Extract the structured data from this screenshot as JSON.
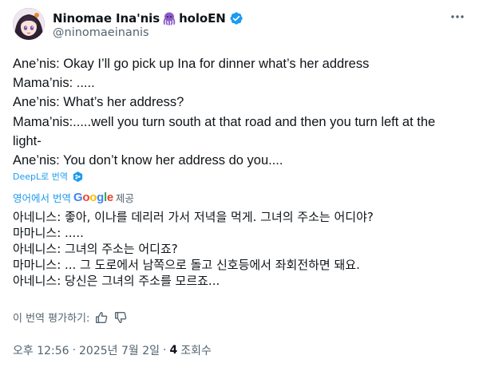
{
  "author": {
    "display_name": "Ninomae Ina'nis",
    "emoji_icon": "octopus-icon",
    "org_tag": "holoEN",
    "handle": "@ninomaeinanis",
    "verified": true,
    "verified_color": "#1d9bf0"
  },
  "tweet": {
    "lines": [
      "Ane’nis: Okay I’ll go pick up Ina for dinner what’s her address",
      "Mama’nis: .....",
      "Ane’nis: What’s her address?",
      "Mama’nis:.....well you turn south at that road and then you turn left at the light-",
      "Ane’nis: You don’t know her address do you...."
    ]
  },
  "deepl": {
    "label": "DeepL로 번역",
    "icon": "deepl-icon"
  },
  "translation": {
    "translated_from_label": "영어에서 번역",
    "provider": "Google",
    "provided_label": "제공",
    "lines": [
      "아네니스: 좋아, 이나를 데리러 가서 저녁을 먹게. 그녀의 주소는 어디야?",
      "마마니스: .....",
      "아네니스: 그녀의 주소는 어디죠?",
      "마마니스: ... 그 도로에서 남쪽으로 돌고 신호등에서 좌회전하면 돼요.",
      "아네니스: 당신은 그녀의 주소를 모르죠..."
    ]
  },
  "rate": {
    "label": "이 번역 평가하기:"
  },
  "meta": {
    "time": "오후 12:56",
    "separator": "·",
    "date": "2025년 7월 2일",
    "views_count": "4",
    "views_label": "조회수"
  },
  "colors": {
    "text": "#0f1419",
    "secondary": "#536471",
    "link": "#1d9bf0"
  }
}
